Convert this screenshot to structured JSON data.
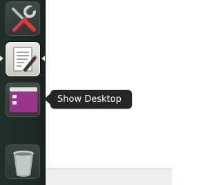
{
  "launcher": {
    "items": [
      {
        "icon": "system-settings-icon"
      },
      {
        "icon": "text-editor-icon",
        "running": true
      },
      {
        "icon": "show-desktop-icon"
      },
      {
        "icon": "trash-icon"
      }
    ]
  },
  "tooltip": {
    "text": "Show Desktop"
  },
  "colors": {
    "launcher_bg": "#1f2b26",
    "tooltip_bg": "#262626",
    "show_desktop_purple": "#9b3b8d"
  }
}
